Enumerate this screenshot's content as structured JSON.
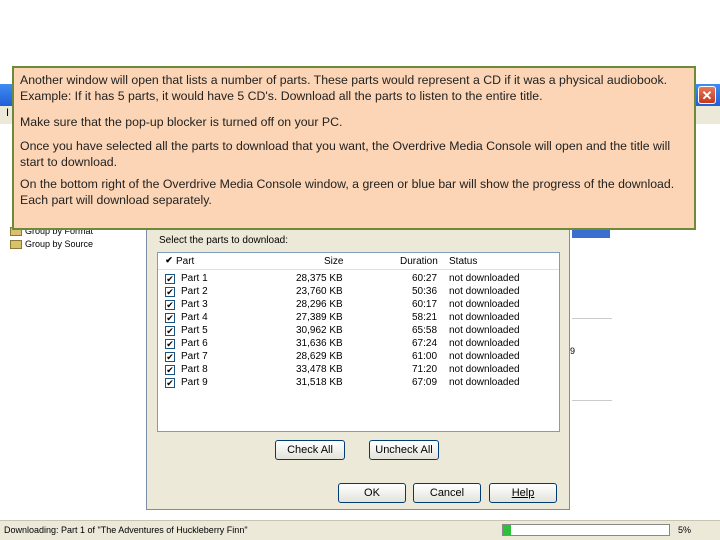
{
  "instructions": {
    "p1": "Another window will open that lists a number of parts. These parts would represent a CD if it was a physical audiobook. Example: If it has 5 parts, it would have 5 CD's. Download all the parts to listen to the entire title.",
    "p2": "Make sure that the pop-up blocker is turned off on your PC.",
    "p3": "Once you have selected all the parts to download that you want, the Overdrive Media Console will open and the title will start to download.",
    "p4": "On the bottom right of the Overdrive Media Console window, a green or blue bar will show the progress of the download. Each part will download separately."
  },
  "background": {
    "menu_partial": "I",
    "tree": [
      "Group by Format",
      "Group by Source"
    ],
    "right_digit": "9"
  },
  "dialog": {
    "label": "Select the parts to download:",
    "columns": {
      "part": "Part",
      "size": "Size",
      "duration": "Duration",
      "status": "Status"
    },
    "rows": [
      {
        "part": "Part 1",
        "size": "28,375 KB",
        "duration": "60:27",
        "status": "not downloaded"
      },
      {
        "part": "Part 2",
        "size": "23,760 KB",
        "duration": "50:36",
        "status": "not downloaded"
      },
      {
        "part": "Part 3",
        "size": "28,296 KB",
        "duration": "60:17",
        "status": "not downloaded"
      },
      {
        "part": "Part 4",
        "size": "27,389 KB",
        "duration": "58:21",
        "status": "not downloaded"
      },
      {
        "part": "Part 5",
        "size": "30,962 KB",
        "duration": "65:58",
        "status": "not downloaded"
      },
      {
        "part": "Part 6",
        "size": "31,636 KB",
        "duration": "67:24",
        "status": "not downloaded"
      },
      {
        "part": "Part 7",
        "size": "28,629 KB",
        "duration": "61:00",
        "status": "not downloaded"
      },
      {
        "part": "Part 8",
        "size": "33,478 KB",
        "duration": "71:20",
        "status": "not downloaded"
      },
      {
        "part": "Part 9",
        "size": "31,518 KB",
        "duration": "67:09",
        "status": "not downloaded"
      }
    ],
    "check_glyph": "✔",
    "buttons": {
      "check_all": "Check All",
      "uncheck_all": "Uncheck All",
      "ok": "OK",
      "cancel": "Cancel",
      "help": "Help"
    }
  },
  "window": {
    "close_glyph": "✕"
  },
  "status_bar": {
    "text": "Downloading: Part 1 of \"The Adventures of Huckleberry Finn\"",
    "progress_percent": 5,
    "progress_label": "5%",
    "progress_color": "#2fbf3b"
  }
}
